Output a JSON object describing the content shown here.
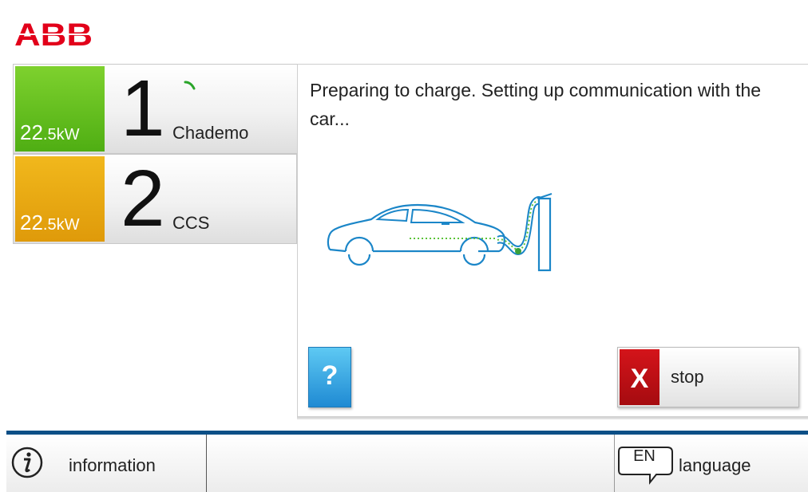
{
  "brand": {
    "logo_text": "ABB",
    "logo_color": "#e2001a"
  },
  "connectors": [
    {
      "number": "1",
      "power_value": "22",
      "power_unit": ".5kW",
      "type": "Chademo",
      "status_color": "#5cb81a",
      "state": "active"
    },
    {
      "number": "2",
      "power_value": "22",
      "power_unit": ".5kW",
      "type": "CCS",
      "status_color": "#e8a812",
      "state": "available"
    }
  ],
  "main": {
    "status_message": "Preparing to charge. Setting up communication with the car...",
    "illustration_icon": "car-charging-icon",
    "help_label": "?",
    "stop_icon_label": "X",
    "stop_label": "stop"
  },
  "footer": {
    "info_label": "information",
    "language_code": "EN",
    "language_label": "language",
    "accent_color": "#0c4f86"
  }
}
